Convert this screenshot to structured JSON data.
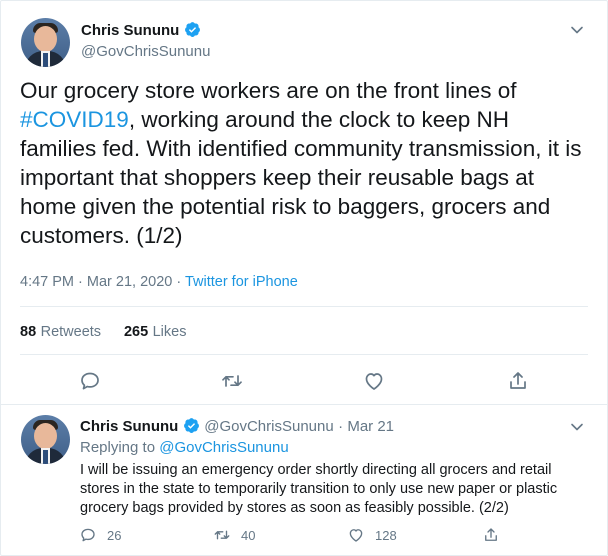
{
  "main_tweet": {
    "author_name": "Chris Sununu",
    "author_handle": "@GovChrisSununu",
    "text_line1": "Our grocery store workers are on the front lines of",
    "hashtag": "#COVID19",
    "text_after_hashtag": ", working around the clock to keep NH families",
    "text_rest": "fed. With identified community transmission, it is important that shoppers keep their reusable bags at home given the potential risk to baggers, grocers and customers. (1/2)",
    "time": "4:47 PM · Mar 21, 2020 · ",
    "source": "Twitter for iPhone",
    "retweets_count": "88",
    "retweets_label": "Retweets",
    "likes_count": "265",
    "likes_label": "Likes"
  },
  "reply_tweet": {
    "author_name": "Chris Sununu",
    "author_handle": "@GovChrisSununu",
    "date": "· Mar 21",
    "replying_to_label": "Replying to ",
    "replying_to_handle": "@GovChrisSununu",
    "text": "I will be issuing an emergency order shortly directing all grocers and retail stores in the state to temporarily transition to only use new paper or plastic grocery bags provided by stores as soon as feasibly possible. (2/2)",
    "reply_count": "26",
    "retweet_count": "40",
    "like_count": "128"
  },
  "colors": {
    "accent": "#1b95e0",
    "verified": "#1da1f2",
    "secondary_text": "#657786",
    "border": "#e6ecf0"
  },
  "icons": [
    "verified-badge-icon",
    "chevron-down-icon",
    "reply-icon",
    "retweet-icon",
    "like-icon",
    "share-icon"
  ]
}
